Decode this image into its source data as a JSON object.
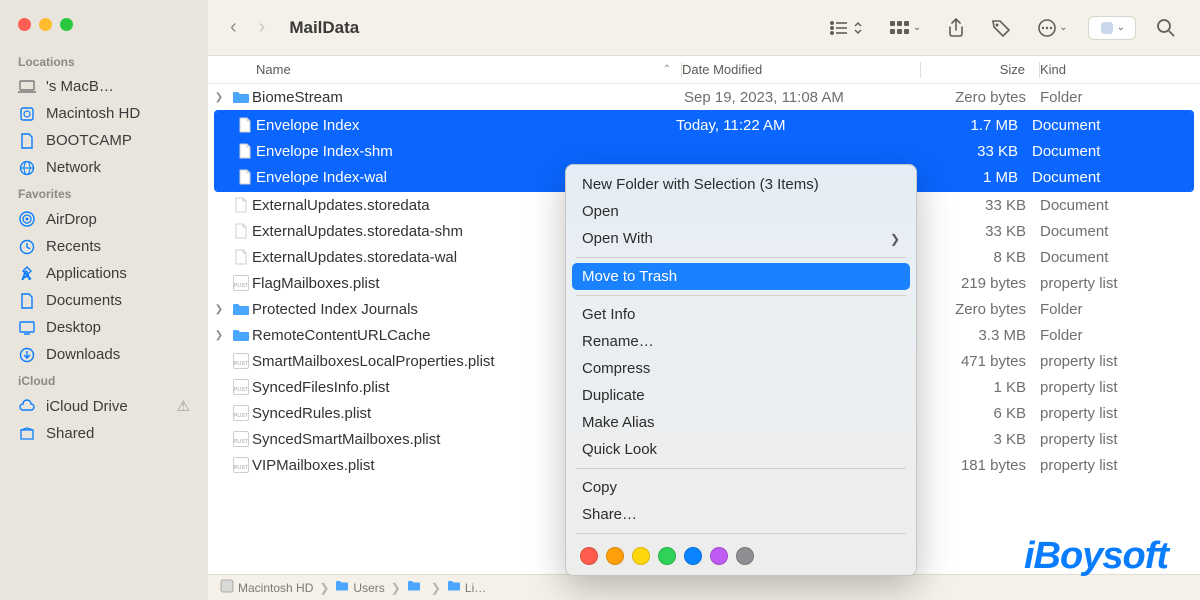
{
  "window": {
    "title": "MailData"
  },
  "columns": {
    "name": "Name",
    "date": "Date Modified",
    "size": "Size",
    "kind": "Kind"
  },
  "sidebar": {
    "sections": [
      {
        "label": "Locations",
        "items": [
          {
            "icon": "laptop",
            "label": "'s MacB…",
            "gray": true
          },
          {
            "icon": "hdd",
            "label": "Macintosh HD"
          },
          {
            "icon": "doc",
            "label": "BOOTCAMP"
          },
          {
            "icon": "globe",
            "label": "Network"
          }
        ]
      },
      {
        "label": "Favorites",
        "items": [
          {
            "icon": "airdrop",
            "label": "AirDrop"
          },
          {
            "icon": "clock",
            "label": "Recents"
          },
          {
            "icon": "apps",
            "label": "Applications"
          },
          {
            "icon": "doc",
            "label": "Documents"
          },
          {
            "icon": "desktop",
            "label": "Desktop"
          },
          {
            "icon": "download",
            "label": "Downloads"
          }
        ]
      },
      {
        "label": "iCloud",
        "items": [
          {
            "icon": "cloud",
            "label": "iCloud Drive",
            "warn": true
          },
          {
            "icon": "shared",
            "label": "Shared"
          }
        ]
      }
    ]
  },
  "files": [
    {
      "type": "folder",
      "expandable": true,
      "name": "BiomeStream",
      "date": "Sep 19, 2023, 11:08 AM",
      "size": "Zero bytes",
      "kind": "Folder",
      "selected": false
    },
    {
      "type": "doc",
      "name": "Envelope Index",
      "date": "Today, 11:22 AM",
      "size": "1.7 MB",
      "kind": "Document",
      "selected": true
    },
    {
      "type": "doc",
      "name": "Envelope Index-shm",
      "date": "",
      "size": "33 KB",
      "kind": "Document",
      "selected": true
    },
    {
      "type": "doc",
      "name": "Envelope Index-wal",
      "date": "",
      "size": "1 MB",
      "kind": "Document",
      "selected": true
    },
    {
      "type": "doc",
      "name": "ExternalUpdates.storedata",
      "date": "",
      "size": "33 KB",
      "kind": "Document",
      "selected": false
    },
    {
      "type": "doc",
      "name": "ExternalUpdates.storedata-shm",
      "date": "",
      "size": "33 KB",
      "kind": "Document",
      "selected": false
    },
    {
      "type": "doc",
      "name": "ExternalUpdates.storedata-wal",
      "date": "",
      "size": "8 KB",
      "kind": "Document",
      "selected": false
    },
    {
      "type": "plist",
      "name": "FlagMailboxes.plist",
      "date": "",
      "size": "219 bytes",
      "kind": "property list",
      "selected": false
    },
    {
      "type": "folder",
      "expandable": true,
      "name": "Protected Index Journals",
      "date": "",
      "size": "Zero bytes",
      "kind": "Folder",
      "selected": false
    },
    {
      "type": "folder",
      "expandable": true,
      "name": "RemoteContentURLCache",
      "date": "",
      "size": "3.3 MB",
      "kind": "Folder",
      "selected": false
    },
    {
      "type": "plist",
      "name": "SmartMailboxesLocalProperties.plist",
      "date": "",
      "size": "471 bytes",
      "kind": "property list",
      "selected": false
    },
    {
      "type": "plist",
      "name": "SyncedFilesInfo.plist",
      "date": "",
      "size": "1 KB",
      "kind": "property list",
      "selected": false
    },
    {
      "type": "plist",
      "name": "SyncedRules.plist",
      "date": "",
      "size": "6 KB",
      "kind": "property list",
      "selected": false
    },
    {
      "type": "plist",
      "name": "SyncedSmartMailboxes.plist",
      "date": "",
      "size": "3 KB",
      "kind": "property list",
      "selected": false
    },
    {
      "type": "plist",
      "name": "VIPMailboxes.plist",
      "date": "",
      "size": "181 bytes",
      "kind": "property list",
      "selected": false
    }
  ],
  "context_menu": {
    "items": [
      {
        "label": "New Folder with Selection (3 Items)"
      },
      {
        "label": "Open"
      },
      {
        "label": "Open With",
        "submenu": true
      },
      {
        "sep": true
      },
      {
        "label": "Move to Trash",
        "hover": true
      },
      {
        "sep": true
      },
      {
        "label": "Get Info"
      },
      {
        "label": "Rename…"
      },
      {
        "label": "Compress"
      },
      {
        "label": "Duplicate"
      },
      {
        "label": "Make Alias"
      },
      {
        "label": "Quick Look"
      },
      {
        "sep": true
      },
      {
        "label": "Copy"
      },
      {
        "label": "Share…"
      },
      {
        "sep": true
      }
    ],
    "tags": [
      "#ff5c4d",
      "#ff9f0a",
      "#ffd60a",
      "#30d158",
      "#0a84ff",
      "#bf5af2",
      "#8e8e93"
    ]
  },
  "pathbar": [
    "Macintosh HD",
    "Users",
    "",
    "Li…"
  ],
  "watermark": "iBoysoft"
}
